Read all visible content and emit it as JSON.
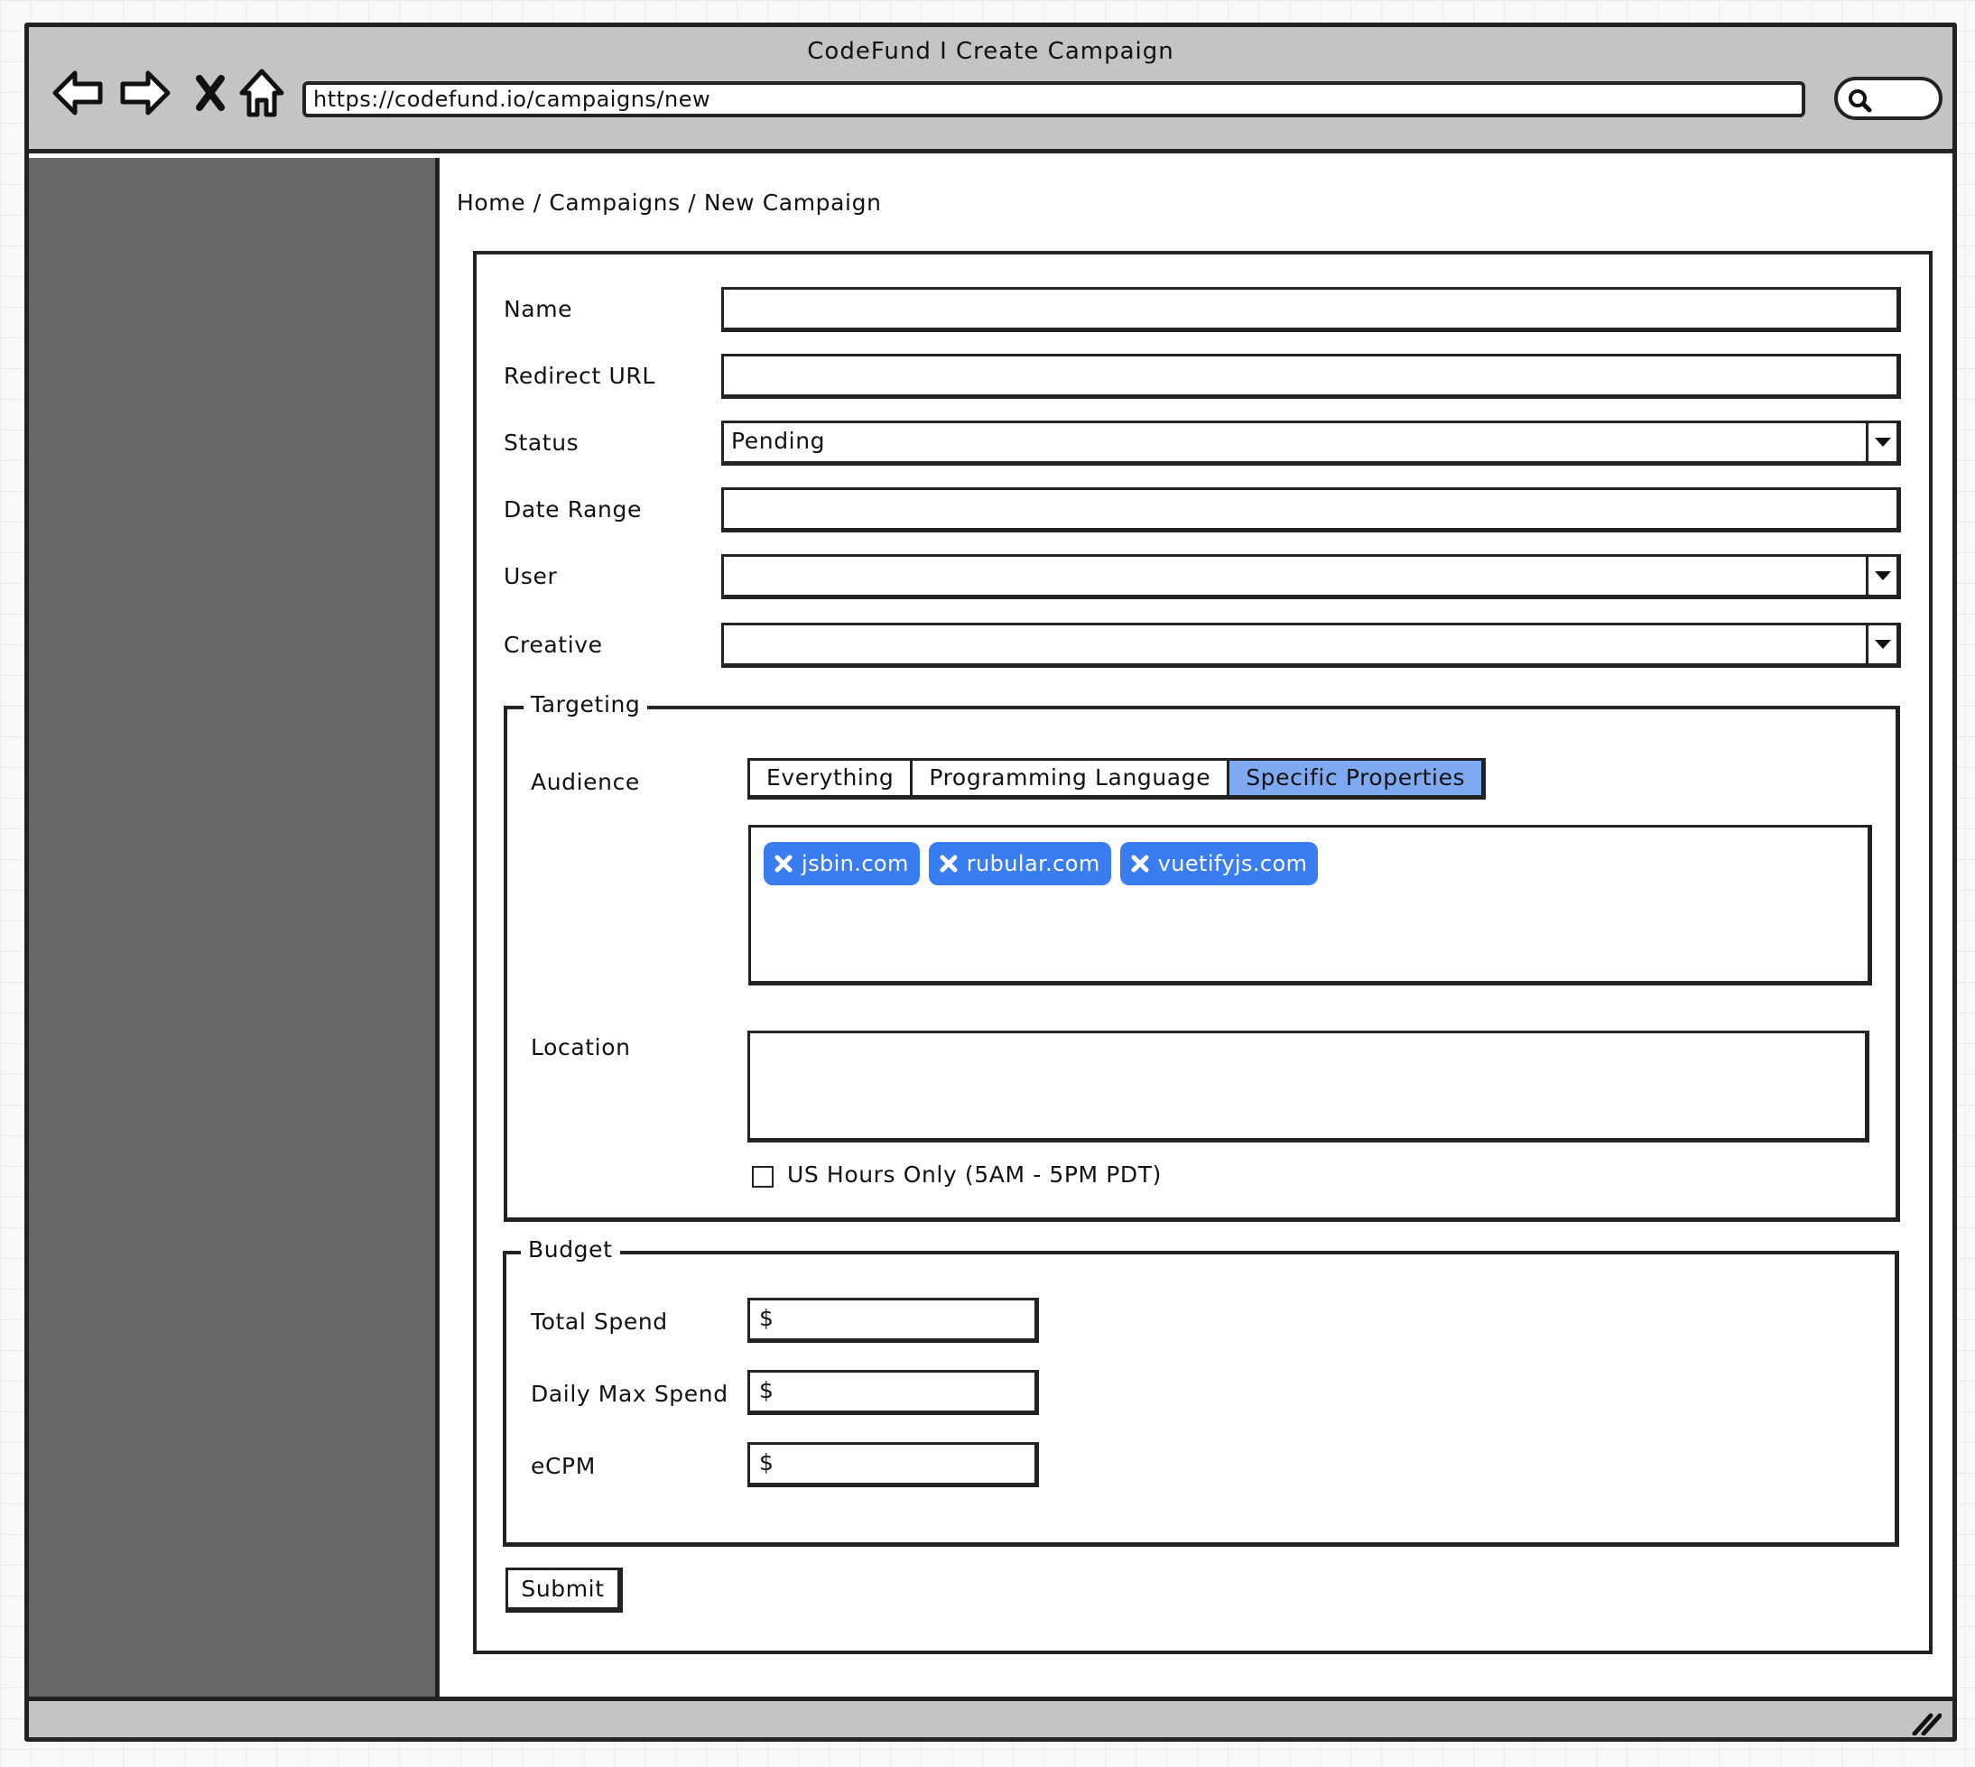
{
  "window": {
    "title": "CodeFund I Create Campaign",
    "url": "https://codefund.io/campaigns/new"
  },
  "icons": {
    "back": "arrow-left-icon",
    "forward": "arrow-right-icon",
    "stop": "close-icon",
    "home": "home-icon",
    "search": "search-icon",
    "resize": "resize-grip-icon"
  },
  "breadcrumb": "Home / Campaigns / New Campaign",
  "form": {
    "name_label": "Name",
    "redirect_label": "Redirect URL",
    "status_label": "Status",
    "status_value": "Pending",
    "daterange_label": "Date Range",
    "user_label": "User",
    "creative_label": "Creative"
  },
  "targeting": {
    "legend": "Targeting",
    "audience_label": "Audience",
    "tabs": [
      "Everything",
      "Programming Language",
      "Specific Properties"
    ],
    "active_tab": "Specific Properties",
    "tags": [
      "jsbin.com",
      "rubular.com",
      "vuetifyjs.com"
    ],
    "location_label": "Location",
    "us_hours_label": "US Hours Only (5AM - 5PM PDT)"
  },
  "budget": {
    "legend": "Budget",
    "total_label": "Total Spend",
    "daily_label": "Daily Max Spend",
    "ecpm_label": "eCPM",
    "currency": "$"
  },
  "submit_label": "Submit",
  "colors": {
    "tag_bg": "#3a7df0",
    "active_tab_bg": "#7faaf2",
    "sidebar": "#666666",
    "chrome": "#c4c4c4"
  }
}
